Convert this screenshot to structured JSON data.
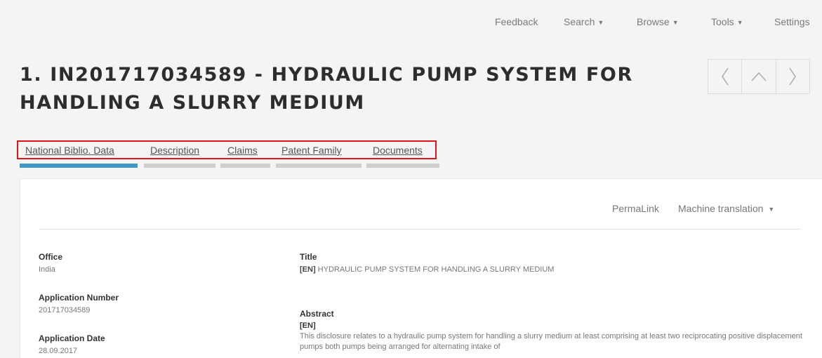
{
  "topnav": {
    "feedback": "Feedback",
    "search": "Search",
    "browse": "Browse",
    "tools": "Tools",
    "settings": "Settings"
  },
  "icons": {
    "caret": "caret-down-icon",
    "prev": "chevron-left-icon",
    "up": "chevron-up-icon",
    "next": "chevron-right-icon"
  },
  "title": "1. IN201717034589 - HYDRAULIC PUMP SYSTEM FOR HANDLING A SLURRY MEDIUM",
  "tabs": [
    {
      "label": "National Biblio. Data",
      "active": true
    },
    {
      "label": "Description",
      "active": false
    },
    {
      "label": "Claims",
      "active": false
    },
    {
      "label": "Patent Family",
      "active": false
    },
    {
      "label": "Documents",
      "active": false
    }
  ],
  "actions": {
    "permalink": "PermaLink",
    "machine_translation": "Machine translation"
  },
  "biblio": {
    "office_label": "Office",
    "office_value": "India",
    "app_number_label": "Application Number",
    "app_number_value": "201717034589",
    "app_date_label": "Application Date",
    "app_date_value": "28.09.2017"
  },
  "main": {
    "title_label": "Title",
    "title_lang": "[EN]",
    "title_value": "HYDRAULIC PUMP SYSTEM FOR HANDLING A SLURRY MEDIUM",
    "abstract_label": "Abstract",
    "abstract_lang": "[EN]",
    "abstract_text": "This disclosure relates to a hydraulic pump system for handling a slurry medium at least comprising at least two reciprocating positive displacement pumps both pumps being arranged for alternating intake of"
  },
  "colors": {
    "accent": "#3d98c3",
    "highlight_box": "#e0141b"
  }
}
